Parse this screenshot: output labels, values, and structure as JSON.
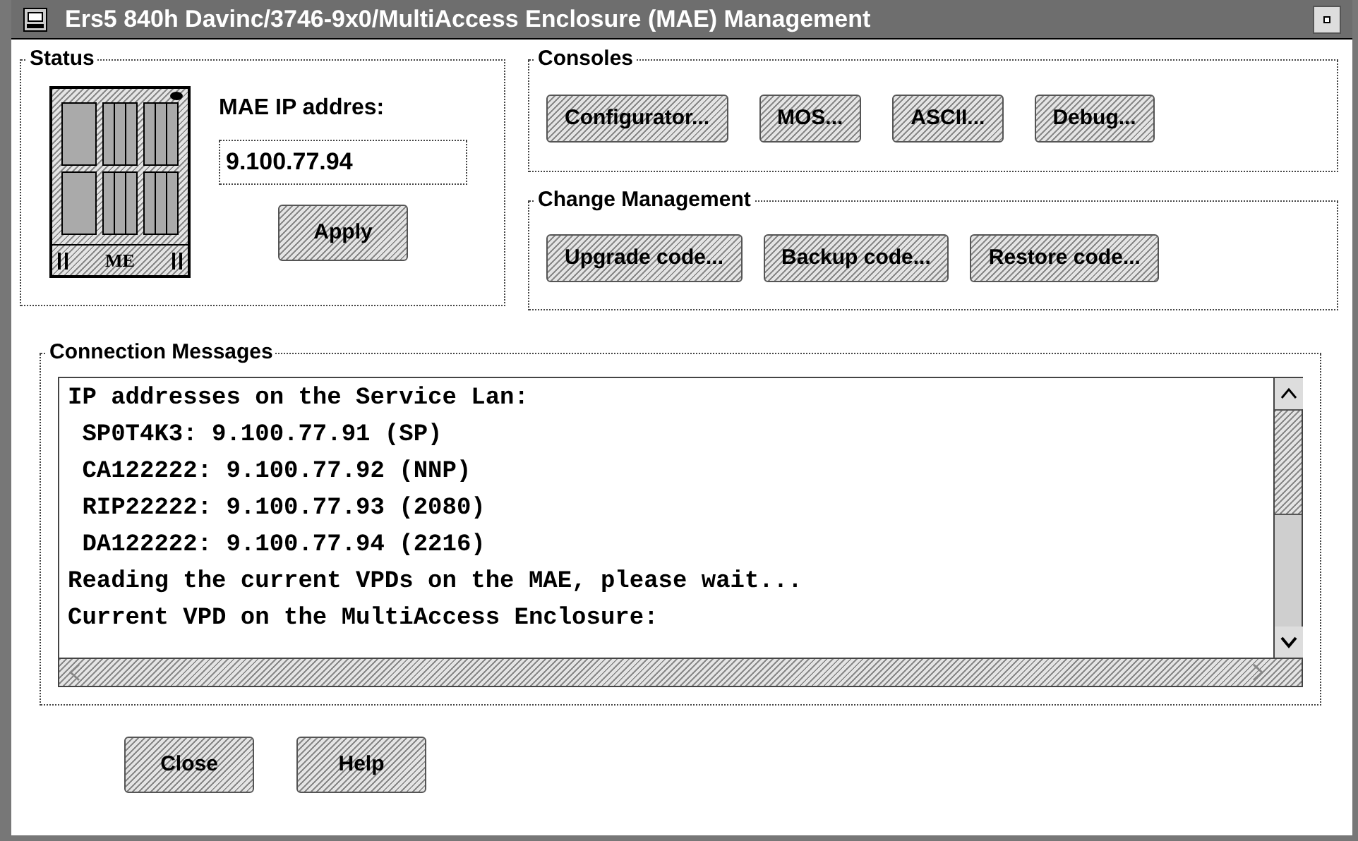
{
  "window": {
    "title": "Ers5 840h Davinc/3746-9x0/MultiAccess Enclosure (MAE) Management"
  },
  "status": {
    "title": "Status",
    "device_label": "ME",
    "ip_label": "MAE IP addres:",
    "ip_value": "9.100.77.94",
    "apply_button": "Apply"
  },
  "consoles": {
    "title": "Consoles",
    "buttons": [
      "Configurator...",
      "MOS...",
      "ASCII...",
      "Debug..."
    ]
  },
  "change_management": {
    "title": "Change Management",
    "buttons": [
      "Upgrade code...",
      "Backup code...",
      "Restore code..."
    ]
  },
  "connection_messages": {
    "title": "Connection Messages",
    "lines": [
      "IP addresses on the Service Lan:",
      " SP0T4K3: 9.100.77.91 (SP)",
      " CA122222: 9.100.77.92 (NNP)",
      " RIP22222: 9.100.77.93 (2080)",
      " DA122222: 9.100.77.94 (2216)",
      "Reading the current VPDs on the MAE, please wait...",
      "Current VPD on the MultiAccess Enclosure:"
    ]
  },
  "footer_buttons": [
    "Close",
    "Help"
  ]
}
